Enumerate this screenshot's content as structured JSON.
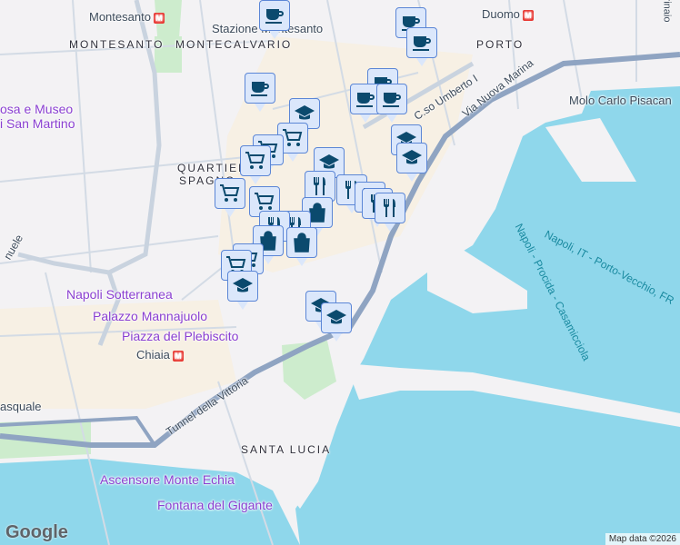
{
  "colors": {
    "water": "#8fd7eb",
    "land": "#f3f2f4",
    "road": "#c9d3df",
    "highway": "#8fa4c2",
    "park": "#cdeccd",
    "marker_bg": "#dbe7fb",
    "marker_icon": "#0b4a6e"
  },
  "labels": {
    "montesanto_station": "Montesanto",
    "montesanto": "MONTESANTO",
    "montecalvario": "MONTECALVARIO",
    "stazione": "Stazione Montesanto",
    "duomo": "Duomo",
    "porto": "PORTO",
    "museo1": "osa e Museo",
    "museo2": "i San Martino",
    "quartieri1": "QUARTIER",
    "quartieri2": "SPAGNO",
    "corso": "C.so Umberto I",
    "via_marina": "Via Nuova Marina",
    "molo": "Molo Carlo Pisacan",
    "ferry1": "Napoli, IT - Porto-Vecchio, FR",
    "ferry2": "Napoli - Procida - Casamicciola",
    "sotterranea": "Napoli Sotterranea",
    "palazzo": "Palazzo Mannajuolo",
    "plebiscito": "Piazza del Plebiscito",
    "chiaia": "Chiaia",
    "pasquale": "asquale",
    "tunnel": "Tunnel della Vittoria",
    "santa_lucia": "SANTA LUCIA",
    "ascensore": "Ascensore Monte Echia",
    "fontana": "Fontana del Gigante",
    "emanuele": "nuele",
    "rinaio": "rinaio",
    "metro_glyph": "M"
  },
  "branding": {
    "logo": "Google",
    "credit": "Map data ©2026"
  },
  "markers_legend": [
    "coffee-icon",
    "education-icon",
    "shopping-cart-icon",
    "restaurant-icon",
    "shopping-bag-icon"
  ]
}
